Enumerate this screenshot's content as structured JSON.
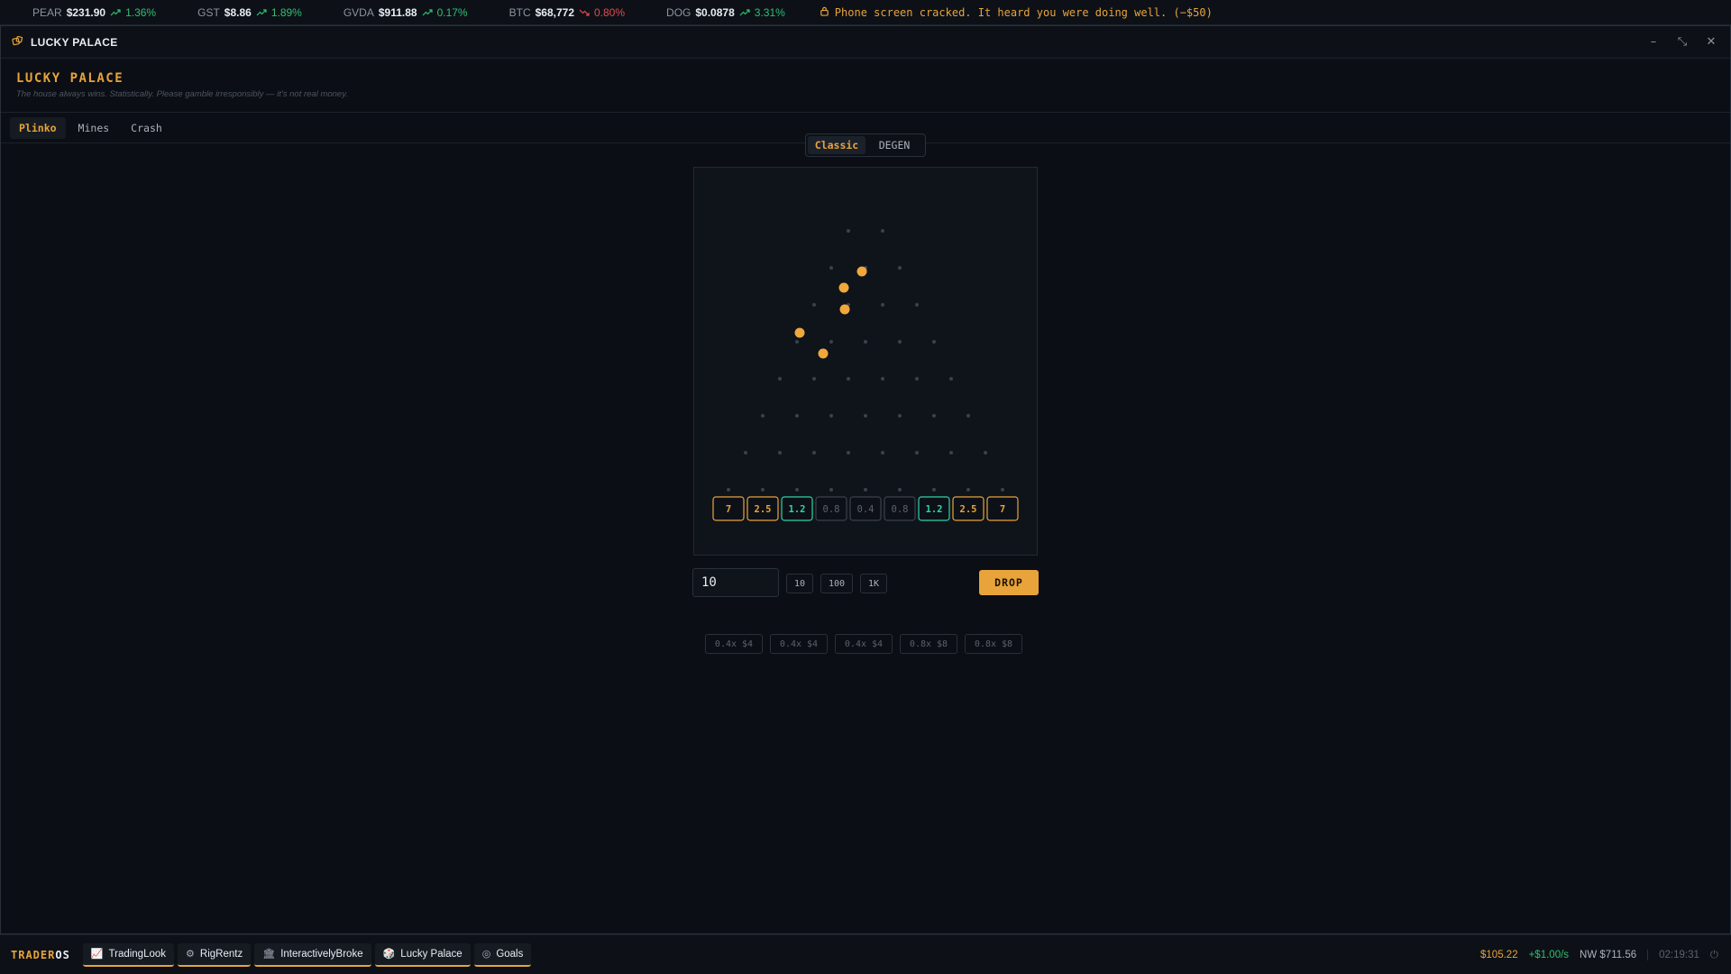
{
  "ticker": [
    {
      "symbol": "PEAR",
      "price": "$231.90",
      "change": "1.36%",
      "dir": "up"
    },
    {
      "symbol": "GST",
      "price": "$8.86",
      "change": "1.89%",
      "dir": "up"
    },
    {
      "symbol": "GVDA",
      "price": "$911.88",
      "change": "0.17%",
      "dir": "up"
    },
    {
      "symbol": "BTC",
      "price": "$68,772",
      "change": "0.80%",
      "dir": "down"
    },
    {
      "symbol": "DOG",
      "price": "$0.0878",
      "change": "3.31%",
      "dir": "up"
    }
  ],
  "news": {
    "text": "Phone screen cracked. It heard you were doing well. (−$50)",
    "icon": "lock-icon"
  },
  "window": {
    "title": "LUCKY PALACE",
    "icon": "lucky-palace-icon"
  },
  "app": {
    "title": "LUCKY PALACE",
    "tagline": "The house always wins. Statistically. Please gamble irresponsibly — it's not real money."
  },
  "tabs": [
    "Plinko",
    "Mines",
    "Crash"
  ],
  "active_tab": "Plinko",
  "modes": [
    "Classic",
    "DEGEN"
  ],
  "active_mode": "Classic",
  "plinko": {
    "rows": 8,
    "buckets": [
      {
        "label": "7",
        "tier": "high"
      },
      {
        "label": "2.5",
        "tier": "high"
      },
      {
        "label": "1.2",
        "tier": "mid"
      },
      {
        "label": "0.8",
        "tier": "low"
      },
      {
        "label": "0.4",
        "tier": "low"
      },
      {
        "label": "0.8",
        "tier": "low"
      },
      {
        "label": "1.2",
        "tier": "mid"
      },
      {
        "label": "2.5",
        "tier": "high"
      },
      {
        "label": "7",
        "tier": "high"
      }
    ],
    "colors": {
      "high": "#e8a33a",
      "mid": "#2dd4a7",
      "low": "#5a626d",
      "ball": "#f0a83a",
      "peg": "#3b424c"
    }
  },
  "bet": {
    "value": "10",
    "chips": [
      "10",
      "100",
      "1K"
    ],
    "drop_label": "DROP"
  },
  "history": [
    "0.4x $4",
    "0.4x $4",
    "0.4x $4",
    "0.8x $8",
    "0.8x $8"
  ],
  "taskbar": {
    "brand_a": "TRADER",
    "brand_b": "OS",
    "apps": [
      {
        "label": "TradingLook",
        "icon": "chart-icon",
        "glyph": "📈"
      },
      {
        "label": "RigRentz",
        "icon": "gear-icon",
        "glyph": "⚙"
      },
      {
        "label": "InteractivelyBroke",
        "icon": "bank-icon",
        "glyph": "🏛"
      },
      {
        "label": "Lucky Palace",
        "icon": "dice-icon",
        "glyph": "🎲"
      },
      {
        "label": "Goals",
        "icon": "target-icon",
        "glyph": "◎"
      }
    ],
    "cash": "$105.22",
    "rate": "+$1.00/s",
    "net_worth": "NW $711.56",
    "clock": "02:19:31"
  }
}
